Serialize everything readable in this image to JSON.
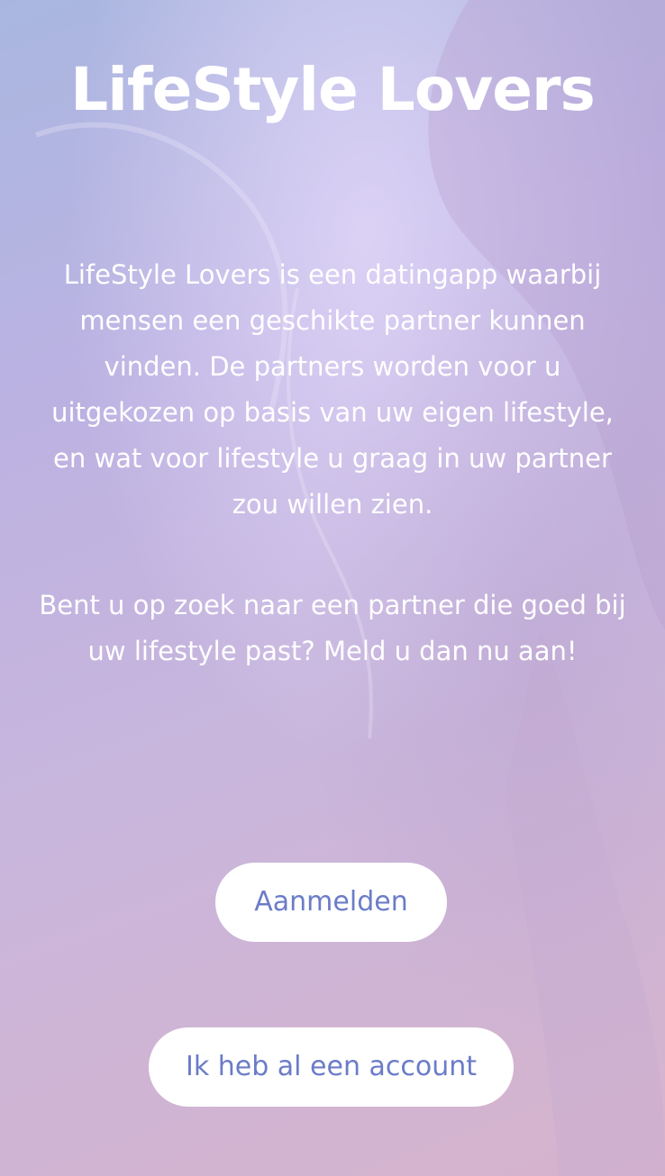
{
  "app": {
    "title": "LifeStyle Lovers"
  },
  "intro": {
    "paragraph_1": "LifeStyle Lovers is een datingapp waarbij mensen een geschikte partner kunnen vinden. De partners worden voor u uitgekozen op basis van uw eigen lifestyle, en wat voor lifestyle u graag in uw partner zou willen zien.",
    "paragraph_2": "Bent u op zoek naar een partner die goed bij uw lifestyle past? Meld u dan nu aan!"
  },
  "actions": {
    "register_label": "Aanmelden",
    "login_label": "Ik heb al een account"
  },
  "colors": {
    "button_text": "#6b7cc8",
    "button_bg": "#ffffff",
    "text": "#ffffff"
  }
}
